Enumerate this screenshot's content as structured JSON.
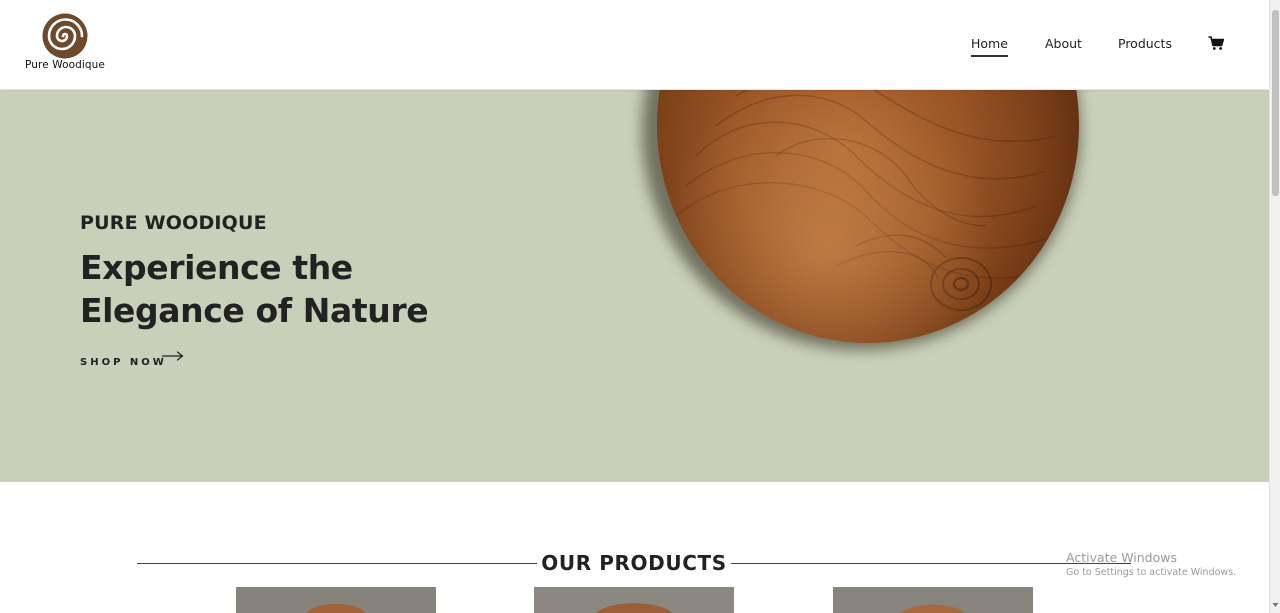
{
  "header": {
    "logo_text": "Pure Woodique",
    "nav": {
      "home": "Home",
      "about": "About",
      "products": "Products"
    },
    "active_nav": "Home",
    "cart_icon": "cart-icon"
  },
  "hero": {
    "eyebrow": "PURE WOODIQUE",
    "title": "Experience the Elegance of Nature",
    "cta_label": "SHOP NOW",
    "cta_icon": "arrow-right-icon",
    "background_color": "#c9d0b9"
  },
  "products_section": {
    "title": "OUR PRODUCTS",
    "card_count_visible": 3
  },
  "watermark": {
    "title": "Activate Windows",
    "subtitle": "Go to Settings to activate Windows."
  },
  "colors": {
    "brand_brown": "#6e4a2c",
    "hero_bg": "#c9d0b9",
    "text_dark": "#222222"
  }
}
